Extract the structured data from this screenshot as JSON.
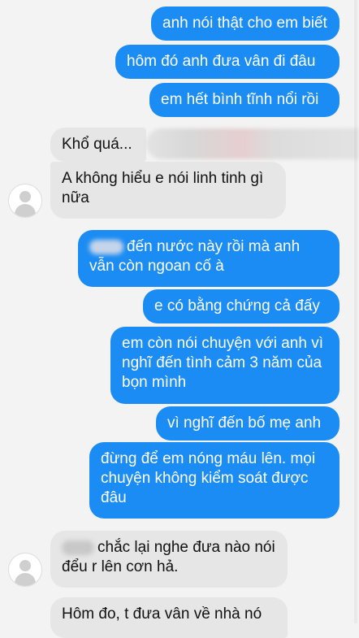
{
  "messages": [
    {
      "side": "out",
      "text": "anh nói thật cho em biết"
    },
    {
      "side": "out",
      "text": "hôm đó anh đưa vân đi đâu"
    },
    {
      "side": "out",
      "text": "em hết bình tĩnh nổi rồi"
    },
    {
      "side": "in",
      "text": "Khổ quá..."
    },
    {
      "side": "in",
      "text": "A không hiểu e nói linh tinh gì nữa"
    },
    {
      "side": "out",
      "text": "đến nước này rồi mà anh vẫn còn ngoan cố à"
    },
    {
      "side": "out",
      "text": "e có bằng chứng cả đấy"
    },
    {
      "side": "out",
      "text": "em còn nói chuyện với anh vì nghĩ đến tình cảm 3 năm của bọn mình"
    },
    {
      "side": "out",
      "text": "vì nghĩ đến bố mẹ anh"
    },
    {
      "side": "out",
      "text": "đừng để em nóng máu lên. mọi chuyện không kiểm soát được đâu"
    },
    {
      "side": "in",
      "text": "chắc lại nghe đưa nào nói đểu r lên cơn hả."
    },
    {
      "side": "in",
      "text": "Hôm đo, t đưa vân về nhà nó"
    }
  ],
  "colors": {
    "outgoing": "#1a8cf3",
    "incoming": "#e6e6e6",
    "background": "#f3f3f3"
  }
}
